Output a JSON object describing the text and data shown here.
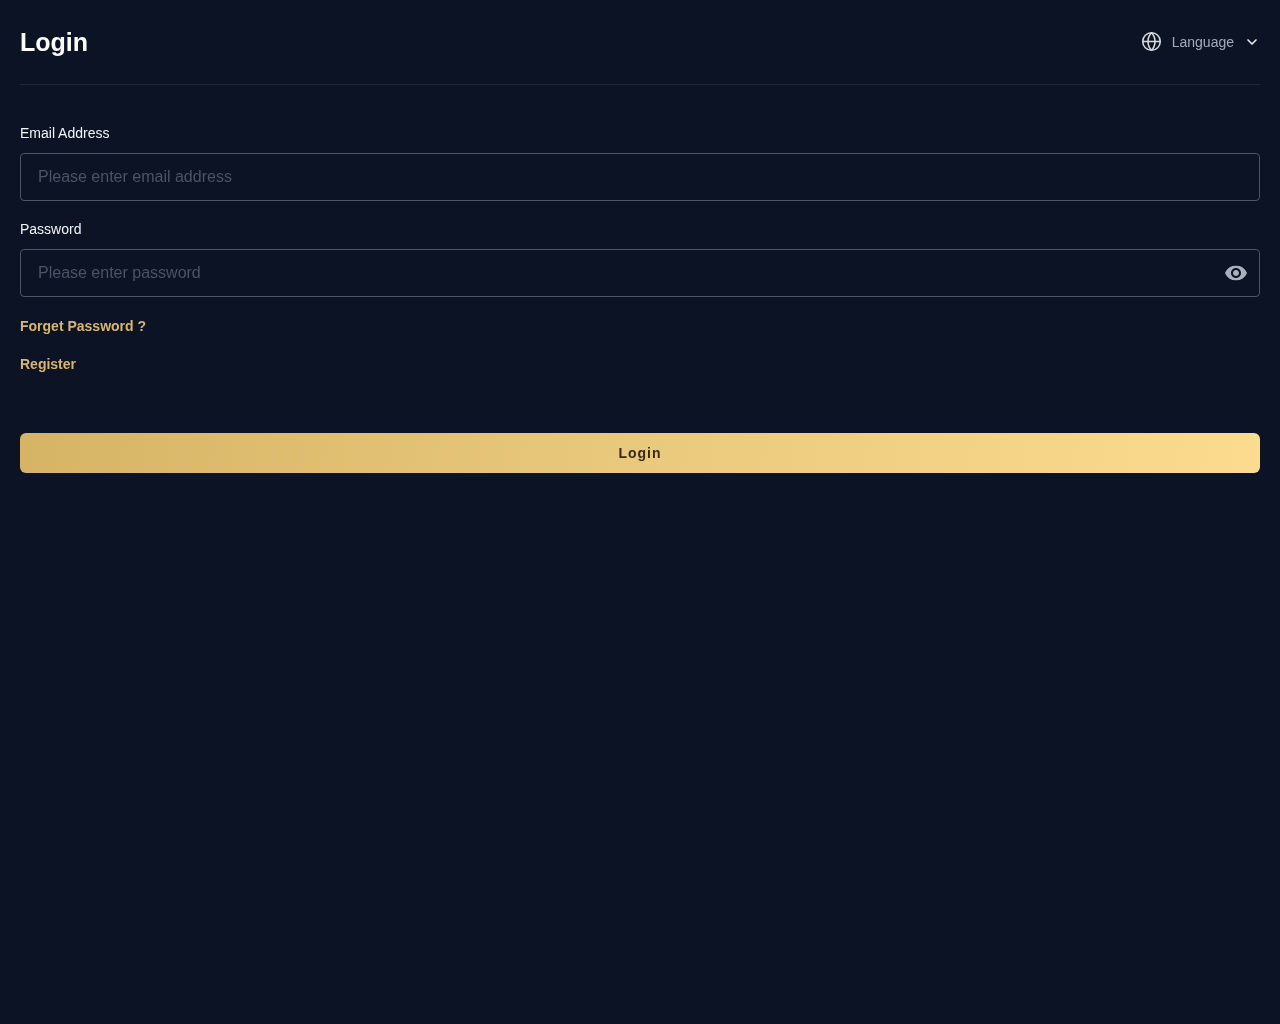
{
  "header": {
    "title": "Login",
    "language": {
      "label": "Language"
    }
  },
  "form": {
    "fields": [
      {
        "kind": "email",
        "label": "Email Address",
        "placeholder": "Please enter email address"
      },
      {
        "kind": "password",
        "label": "Password",
        "placeholder": "Please enter password"
      }
    ],
    "links": [
      "Forget Password ?",
      "Register"
    ],
    "submit": "Login"
  }
}
